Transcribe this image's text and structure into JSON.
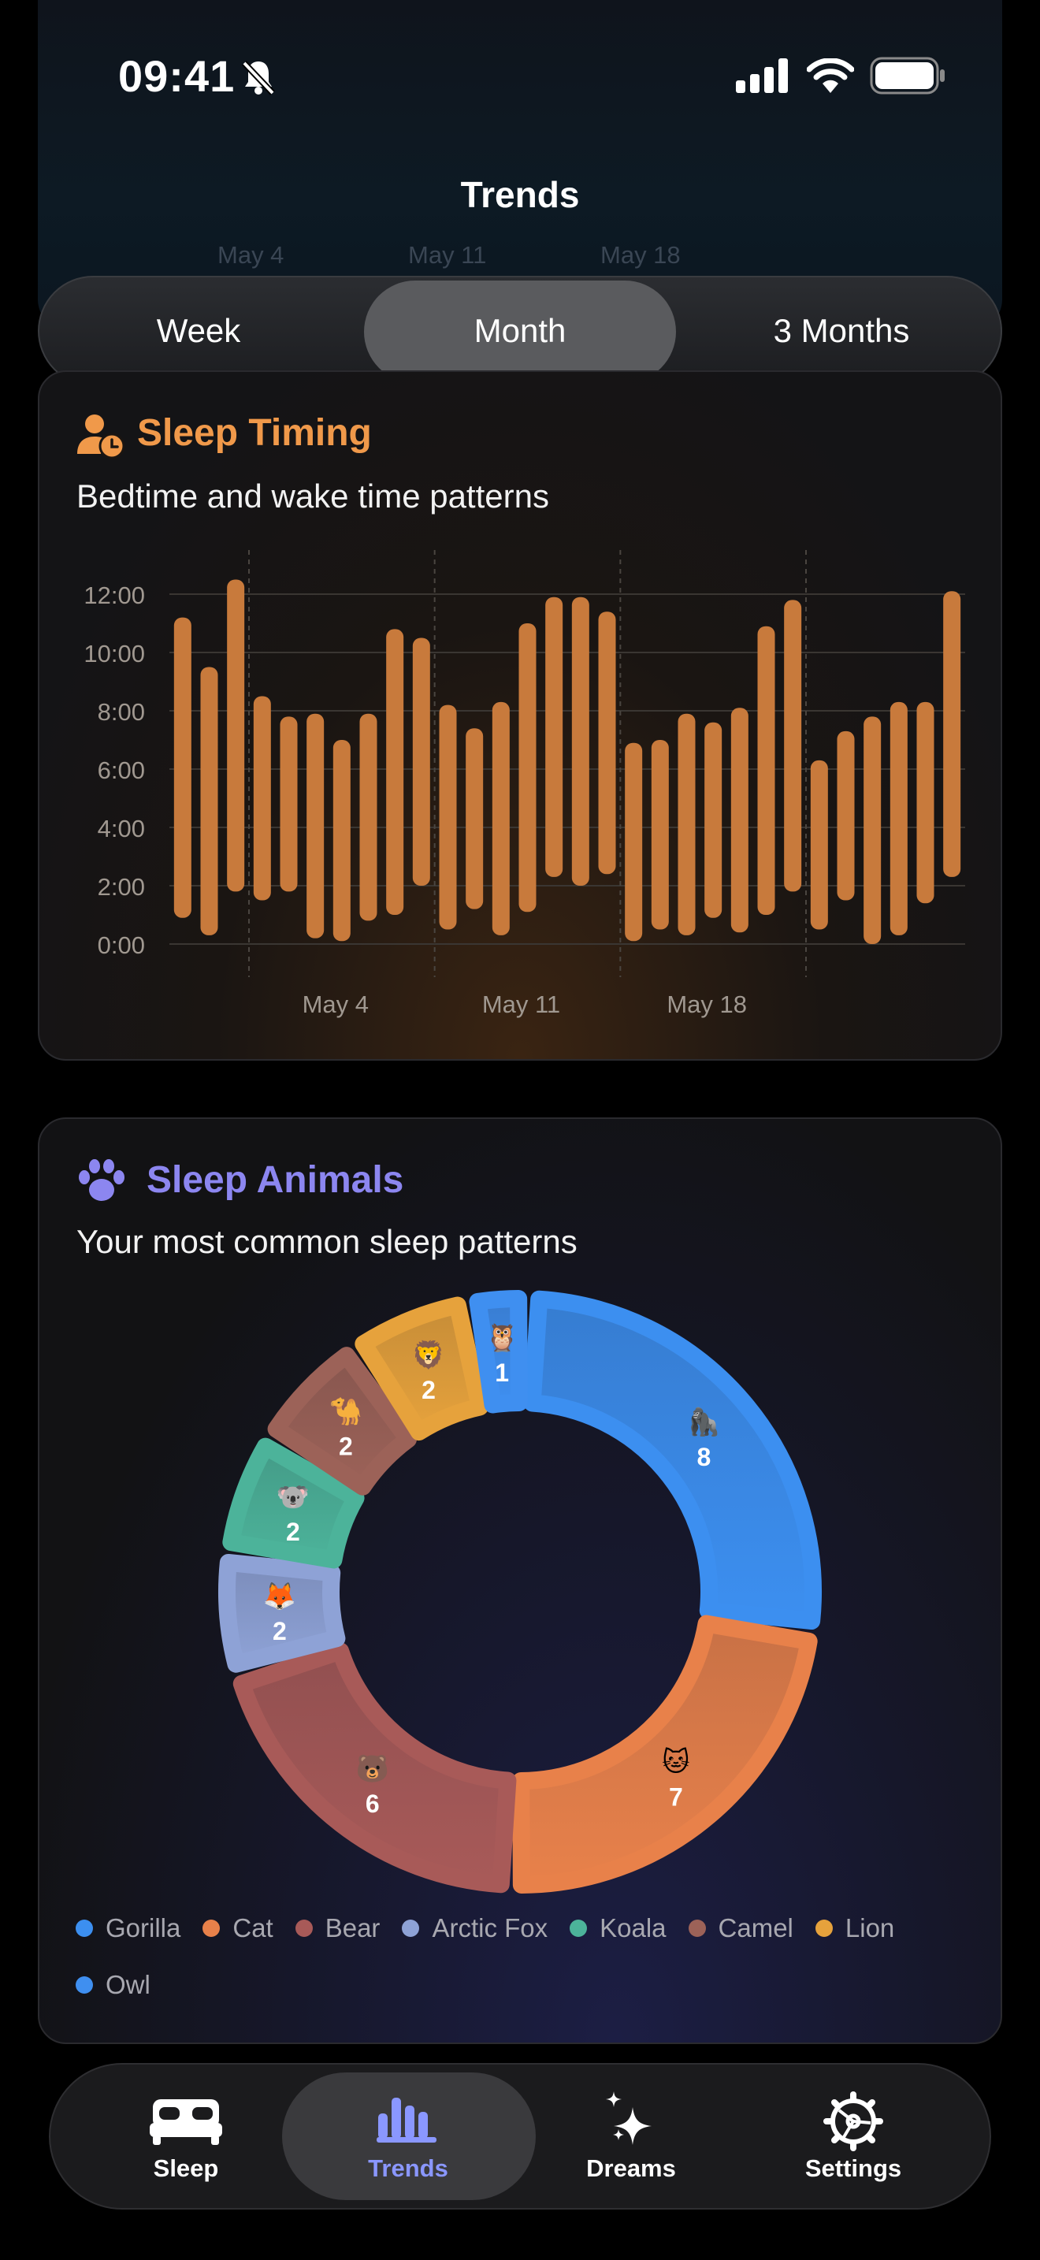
{
  "status": {
    "time": "09:41"
  },
  "header": {
    "title": "Trends",
    "ghost_dates": [
      "May 4",
      "May 11",
      "May 18"
    ]
  },
  "segmented": {
    "options": [
      "Week",
      "Month",
      "3 Months"
    ],
    "selected": "Month"
  },
  "sleep_timing": {
    "title": "Sleep Timing",
    "subtitle": "Bedtime and wake time patterns",
    "accent": "#f0994a",
    "chart_data": {
      "type": "bar",
      "subtype": "floating-range",
      "y_tick_labels": [
        "0:00",
        "2:00",
        "4:00",
        "6:00",
        "8:00",
        "10:00",
        "12:00"
      ],
      "ylim": [
        0,
        12
      ],
      "x_tick_labels": [
        "May 4",
        "May 11",
        "May 18"
      ],
      "x_tick_indices": [
        3,
        10,
        17,
        24
      ],
      "x_label_indices": [
        6,
        13,
        20
      ],
      "grid": true,
      "bar_color": "#c87a3c",
      "series": [
        {
          "values": [
            [
              0.9,
              11.2
            ],
            [
              0.3,
              9.5
            ],
            [
              1.8,
              12.5
            ],
            [
              1.5,
              8.5
            ],
            [
              1.8,
              7.8
            ],
            [
              0.2,
              7.9
            ],
            [
              0.1,
              7.0
            ],
            [
              0.8,
              7.9
            ],
            [
              1.0,
              10.8
            ],
            [
              2.0,
              10.5
            ],
            [
              0.5,
              8.2
            ],
            [
              1.2,
              7.4
            ],
            [
              0.3,
              8.3
            ],
            [
              1.1,
              11.0
            ],
            [
              2.3,
              11.9
            ],
            [
              2.0,
              11.9
            ],
            [
              2.4,
              11.4
            ],
            [
              0.1,
              6.9
            ],
            [
              0.5,
              7.0
            ],
            [
              0.3,
              7.9
            ],
            [
              0.9,
              7.6
            ],
            [
              0.4,
              8.1
            ],
            [
              1.0,
              10.9
            ],
            [
              1.8,
              11.8
            ],
            [
              0.5,
              6.3
            ],
            [
              1.5,
              7.3
            ],
            [
              0.0,
              7.8
            ],
            [
              0.3,
              8.3
            ],
            [
              1.4,
              8.3
            ],
            [
              2.3,
              12.1
            ]
          ]
        }
      ]
    }
  },
  "sleep_animals": {
    "title": "Sleep Animals",
    "subtitle": "Your most common sleep patterns",
    "accent": "#8c86f0",
    "chart_data": {
      "type": "pie",
      "style": "donut",
      "slices": [
        {
          "name": "Gorilla",
          "value": 8,
          "emoji": "🦍",
          "color": "#3c8ff0"
        },
        {
          "name": "Cat",
          "value": 7,
          "emoji": "🐱",
          "color": "#e8814a"
        },
        {
          "name": "Bear",
          "value": 6,
          "emoji": "🐻",
          "color": "#a85a58"
        },
        {
          "name": "Arctic Fox",
          "value": 2,
          "emoji": "🦊",
          "color": "#8ea2d6"
        },
        {
          "name": "Koala",
          "value": 2,
          "emoji": "🐨",
          "color": "#4cb39a"
        },
        {
          "name": "Camel",
          "value": 2,
          "emoji": "🐪",
          "color": "#9c6258"
        },
        {
          "name": "Lion",
          "value": 2,
          "emoji": "🦁",
          "color": "#e6a23c"
        },
        {
          "name": "Owl",
          "value": 1,
          "emoji": "🦉",
          "color": "#3f8ff0"
        }
      ],
      "legend_position": "bottom"
    }
  },
  "tabbar": {
    "items": [
      {
        "label": "Sleep",
        "icon": "bed-icon"
      },
      {
        "label": "Trends",
        "icon": "chart-bars-icon"
      },
      {
        "label": "Dreams",
        "icon": "sparkles-icon"
      },
      {
        "label": "Settings",
        "icon": "gear-icon"
      }
    ],
    "selected": "Trends",
    "selected_color": "#8a97ff"
  }
}
